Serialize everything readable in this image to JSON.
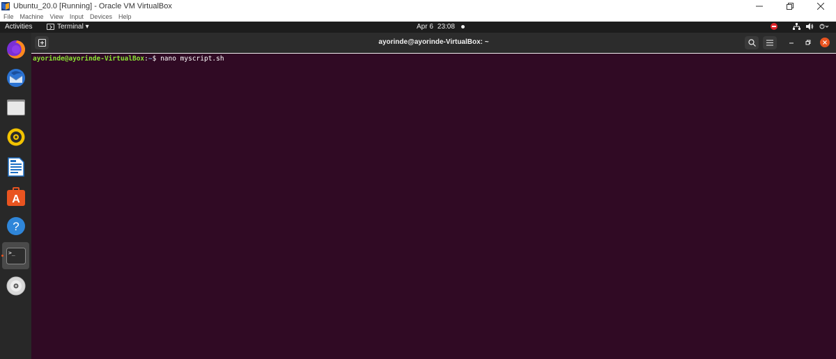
{
  "vbox": {
    "title": "Ubuntu_20.0 [Running] - Oracle VM VirtualBox",
    "menu": [
      "File",
      "Machine",
      "View",
      "Input",
      "Devices",
      "Help"
    ]
  },
  "topbar": {
    "activities": "Activities",
    "app_menu": "Terminal ▾",
    "date": "Apr 6",
    "time": "23:08"
  },
  "dock": {
    "items": [
      {
        "name": "firefox-icon"
      },
      {
        "name": "thunderbird-icon"
      },
      {
        "name": "files-icon"
      },
      {
        "name": "rhythmbox-icon"
      },
      {
        "name": "libreoffice-writer-icon"
      },
      {
        "name": "ubuntu-software-icon"
      },
      {
        "name": "help-icon"
      },
      {
        "name": "terminal-icon",
        "active": true
      },
      {
        "name": "disc-icon"
      }
    ]
  },
  "terminal": {
    "title": "ayorinde@ayorinde-VirtualBox: ~",
    "prompt_user": "ayorinde@ayorinde-VirtualBox",
    "prompt_sep": ":",
    "prompt_path": "~",
    "prompt_symbol": "$ ",
    "command": "nano myscript.sh"
  },
  "colors": {
    "terminal_bg": "#300a24",
    "prompt_user": "#8ae234",
    "prompt_path": "#729fcf",
    "accent": "#e95420"
  }
}
